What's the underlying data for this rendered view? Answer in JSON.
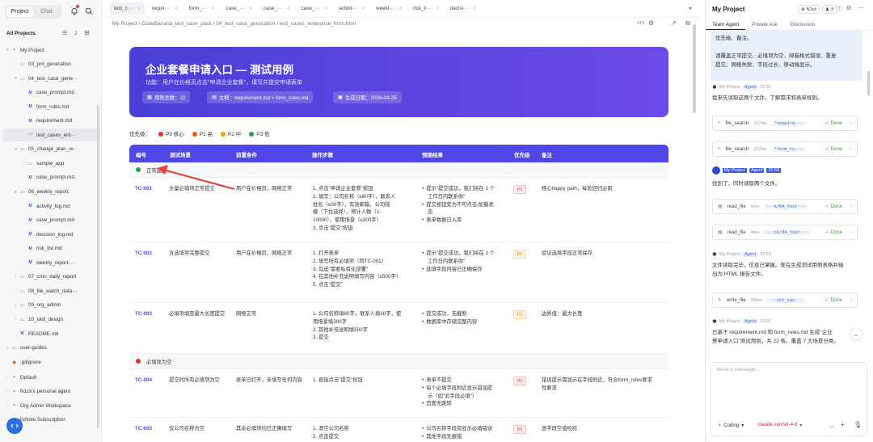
{
  "sidebar": {
    "tabs": [
      "Project",
      "Chat"
    ],
    "section_title": "All Projects",
    "count": "2",
    "items": [
      {
        "label": "My Project",
        "type": "project",
        "indent": 0,
        "selected": false
      },
      {
        "label": "03_prd_generation",
        "type": "folder",
        "indent": 1
      },
      {
        "label": "04_test_case_gene···",
        "type": "folder-open",
        "indent": 1
      },
      {
        "label": "case_prompt.md",
        "type": "md",
        "indent": 2
      },
      {
        "label": "form_rules.md",
        "type": "md",
        "indent": 2
      },
      {
        "label": "requirement.md",
        "type": "md",
        "indent": 2
      },
      {
        "label": "test_cases_ent···",
        "type": "html",
        "indent": 2,
        "selected": true
      },
      {
        "label": "05_change_plan_re···",
        "type": "folder-open",
        "indent": 1
      },
      {
        "label": "sample_app",
        "type": "folder",
        "indent": 2
      },
      {
        "label": "case_prompt.md",
        "type": "md",
        "indent": 2
      },
      {
        "label": "06_weekly_report",
        "type": "folder-open",
        "indent": 1
      },
      {
        "label": "activity_log.md",
        "type": "md",
        "indent": 2
      },
      {
        "label": "case_prompt.md",
        "type": "md",
        "indent": 2
      },
      {
        "label": "decision_log.md",
        "type": "md",
        "indent": 2
      },
      {
        "label": "risk_list.md",
        "type": "md",
        "indent": 2
      },
      {
        "label": "weekly_report.···",
        "type": "md",
        "indent": 2
      },
      {
        "label": "07_cron_daily_report",
        "type": "folder",
        "indent": 1
      },
      {
        "label": "08_file_watch_data···",
        "type": "folder",
        "indent": 1
      },
      {
        "label": "09_org_admin",
        "type": "folder",
        "indent": 1
      },
      {
        "label": "10_skill_design",
        "type": "folder",
        "indent": 1
      },
      {
        "label": "README.md",
        "type": "md",
        "indent": 1
      },
      {
        "label": "user-guides",
        "type": "folder",
        "indent": 0
      },
      {
        "label": ".gitignore",
        "type": "git",
        "indent": 0
      },
      {
        "label": "Default",
        "type": "project",
        "indent": -1
      },
      {
        "label": "N1ck's personal agent",
        "type": "project",
        "indent": -1
      },
      {
        "label": "Org Admin Workspace",
        "type": "project",
        "indent": -1
      },
      {
        "label": "licNote Subscription",
        "type": "project",
        "indent": -1
      }
    ]
  },
  "tabs": [
    "test_c···",
    "requir···",
    "form_···",
    "case_···",
    "case_···",
    "case_···",
    "activit···",
    "weekl···",
    "risk_li···",
    "decisi···"
  ],
  "breadcrumb": "My Project / CodeBanana_test_case_pack / 04_test_case_generation / test_cases_enterprise_form.html",
  "banner": {
    "title": "企业套餐申请入口 — 测试用例",
    "subtitle": "功能：用户在价格页点击\"申请企业套餐\"，填写并提交申请表单",
    "chips": [
      "用例总数：22",
      "文档：requirement.md + form_rules.md",
      "生成日期：2026-04-25"
    ]
  },
  "legend": {
    "label": "优先级：",
    "items": [
      {
        "text": "P0 核心",
        "color": "#e03131"
      },
      {
        "text": "P1 高",
        "color": "#e8590c"
      },
      {
        "text": "P2 中",
        "color": "#f0a400"
      },
      {
        "text": "P3 低",
        "color": "#2f9e44"
      }
    ]
  },
  "table": {
    "headers": [
      "编号",
      "测试场景",
      "前置条件",
      "操作步骤",
      "预期结果",
      "优先级",
      "备注"
    ],
    "groups": [
      {
        "label": "正常提交",
        "color": "#2f9e44",
        "rows": [
          {
            "id": "TC-001",
            "scene": "全量必填项正常提交",
            "pre": "用户在价格页，网络正常",
            "steps": [
              "1. 点击\"申请企业套餐\"按钮",
              "2. 填写：公司名称（≤80字），联系人",
              "姓名（≤30字），有效邮箱，公司规",
              "模（下拉选择），预计人数（1-",
              "10000），使用场景（≤300字）",
              "3. 点击\"提交\"按钮"
            ],
            "expect": [
              "提示\"提交成功，我们将在 1 个",
              "工作日内联系你\"",
              "提交按钮变为不可点击/加载状",
              "态",
              "表单数据已入库"
            ],
            "expect_bullets": [
              0,
              2,
              4
            ],
            "priority": "P0",
            "note": "核心happy path，每轮回归必跑"
          },
          {
            "id": "TC-002",
            "scene": "含选填项完整提交",
            "pre": "用户在价格页，网络正常",
            "steps": [
              "1. 打开表单",
              "2. 填写所有必填项（同TC-001）",
              "3. 勾选\"需要私有化部署\"",
              "4. 在其他补充说明填写内容（≤500字）",
              "5. 点击\"提交\""
            ],
            "expect": [
              "提示\"提交成功，我们将在 1 个",
              "工作日内联系你\"",
              "选填字段内容已正确保存"
            ],
            "expect_bullets": [
              0,
              2
            ],
            "priority": "P1",
            "note": "验证选填字段正常保存"
          },
          {
            "id": "TC-003",
            "scene": "必填项填至最大长度提交",
            "pre": "网络正常",
            "steps": [
              "1. 公司名称填80字，联系人填30字，使",
              "用场景填300字",
              "2. 其他补充说明填500字",
              "3. 提交"
            ],
            "expect": [
              "提交成功，无截断",
              "数据库中存储完整内容"
            ],
            "expect_bullets": [
              0,
              1
            ],
            "priority": "P1",
            "note": "边界值：最大长度"
          }
        ]
      },
      {
        "label": "必填项为空",
        "color": "#e03131",
        "rows": [
          {
            "id": "TC-004",
            "scene": "提交时所有必填项为空",
            "pre": "表单已打开，未填写任何内容",
            "steps": [
              "1. 直接点击\"提交\"按钮"
            ],
            "expect": [
              "表单不提交",
              "每个必填字段附近显示错误提",
              "示（如\"此字段必填\"）",
              "页面无跳转"
            ],
            "expect_bullets": [
              0,
              1,
              3
            ],
            "priority": "P0",
            "note": "错误提示需显示在字段附近，符合form_rules要求",
            "note2": "性要求"
          },
          {
            "id": "TC-005",
            "scene": "仅公司名称为空",
            "pre": "其余必填项均已正确填写",
            "steps": [
              "1. 清空公司名称",
              "2. 点击提交"
            ],
            "expect": [
              "公司名称字段旁显示必填错误",
              "其他字段无报错"
            ],
            "expect_bullets": [
              0,
              1
            ],
            "priority": "P0",
            "note": "逐字段空值校验"
          }
        ]
      }
    ]
  },
  "right_panel": {
    "title": "My Project",
    "user_chip": "N1ck",
    "member_count": "3",
    "tabs": [
      "Team Agent",
      "Private Ask",
      "Discussion"
    ],
    "bubble_lines": [
      "优先级、备注。",
      "",
      "请覆盖正常提交、必填项为空、邮箱格式错误、重复",
      "提交、网络失败、字段过长、移动端显示。"
    ],
    "messages": [
      {
        "sender": "My Project",
        "badge": "Agent",
        "time": "22:59",
        "text": [
          "我来先读取这两个文件，了解需求和表单规则。"
        ]
      },
      {
        "sender": "My Project",
        "badge": "Agent",
        "time": "22:59",
        "text": [
          "找到了，同时读取两个文件。"
        ]
      },
      {
        "sender": "My Project",
        "badge": "Agent",
        "time": "22:59",
        "text": [
          "文件读取完毕，信息已掌握。现在生成测试用例表格并输",
          "出为 HTML 报告文件。"
        ]
      },
      {
        "sender": "My Project",
        "badge": "Agent",
        "time": "23:01",
        "text": [
          "已基于 requirement.md 和 form_rules.md 生成\"企业",
          "餐申请入口\"测试用例，共 22 条，覆盖 7 大场景分类。"
        ]
      }
    ],
    "tools": [
      {
        "name": "file_search",
        "ms": "157ms",
        "arg": "\"require···",
        "status": "Done"
      },
      {
        "name": "file_search",
        "ms": "112ms",
        "arg": "\"form_ru···",
        "status": "Done"
      },
      {
        "name": "read_file",
        "ms": "6ms",
        "arg": "···k/04_test···",
        "status": "Done"
      },
      {
        "name": "read_file",
        "ms": "4ms",
        "arg": "···ck/04_test···",
        "status": "Done"
      },
      {
        "name": "write_file",
        "ms": "39ms",
        "arg": "···est_cas···",
        "status": "Done"
      }
    ],
    "input_placeholder": "Send a message...",
    "mode": "Coding",
    "model": "claude-sonnet-4-6"
  }
}
